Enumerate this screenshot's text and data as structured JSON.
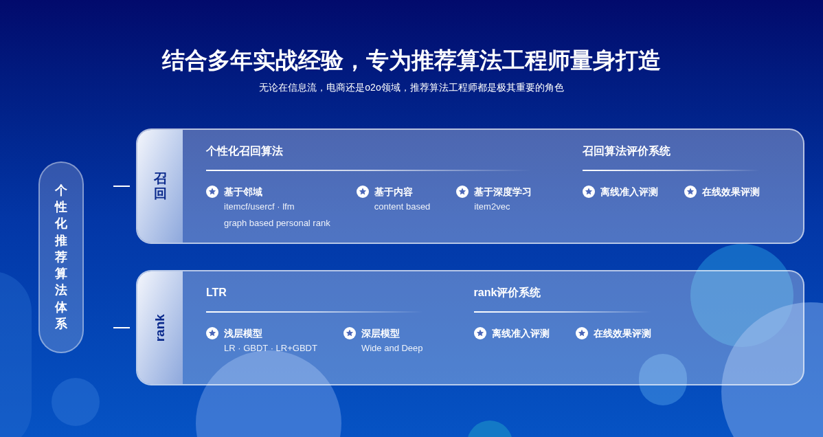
{
  "heading": "结合多年实战经验，专为推荐算法工程师量身打造",
  "subheading": "无论在信息流，电商还是o2o领域，推荐算法工程师都是极其重要的角色",
  "root_label": "个性化推荐算法体系",
  "sections": [
    {
      "label": "召回",
      "kind": "stacked",
      "groups": [
        {
          "title": "个性化召回算法",
          "items": [
            {
              "name": "基于邻域",
              "details": [
                "itemcf/usercf · lfm",
                "graph based personal rank"
              ]
            },
            {
              "name": "基于内容",
              "details": [
                "content based"
              ]
            },
            {
              "name": "基于深度学习",
              "details": [
                "item2vec"
              ]
            }
          ]
        },
        {
          "title": "召回算法评价系统",
          "items": [
            {
              "name": "离线准入评测"
            },
            {
              "name": "在线效果评测"
            }
          ]
        }
      ]
    },
    {
      "label": "rank",
      "kind": "rotated",
      "groups": [
        {
          "title": "LTR",
          "items": [
            {
              "name": "浅层模型",
              "details": [
                "LR · GBDT · LR+GBDT"
              ]
            },
            {
              "name": "深层模型",
              "details": [
                "Wide and Deep"
              ]
            }
          ]
        },
        {
          "title": "rank评价系统",
          "items": [
            {
              "name": "离线准入评测"
            },
            {
              "name": "在线效果评测"
            }
          ]
        }
      ]
    }
  ]
}
